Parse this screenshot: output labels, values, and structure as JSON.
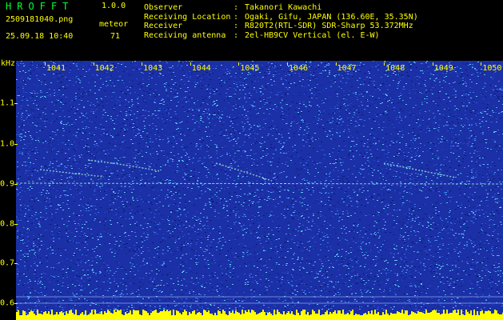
{
  "app": {
    "title": "HROFFT",
    "version": "1.0.0"
  },
  "file": {
    "name": "2509181040.png",
    "datetime": "25.09.18 10:40"
  },
  "detection": {
    "mode": "meteor",
    "count": "71"
  },
  "info": {
    "observer": {
      "label": "Observer",
      "sep": ":",
      "value": "Takanori Kawachi"
    },
    "location": {
      "label": "Receiving Location",
      "sep": ":",
      "value": "Ogaki, Gifu, JAPAN (136.60E, 35.35N)"
    },
    "receiver": {
      "label": "Receiver",
      "sep": ":",
      "value": "R820T2(RTL-SDR) SDR-Sharp 53.372MHz"
    },
    "antenna": {
      "label": "Receiving antenna",
      "sep": ":",
      "value": "2el-HB9CV Vertical (el. E-W)"
    }
  },
  "axis": {
    "unit": "kHz",
    "freq_ticks": [
      "1.1",
      "1.0",
      "0.9",
      "0.8",
      "0.7",
      "0.6"
    ],
    "time_ticks": [
      "1041",
      "1042",
      "1043",
      "1044",
      "1045",
      "1046",
      "1047",
      "1048",
      "1049",
      "1050"
    ]
  },
  "colors": {
    "background": "#1b2fa6",
    "text": "#ffff00",
    "title": "#00ff33",
    "trace": "#b0ffd8",
    "noise_floor": "#ffff00"
  }
}
